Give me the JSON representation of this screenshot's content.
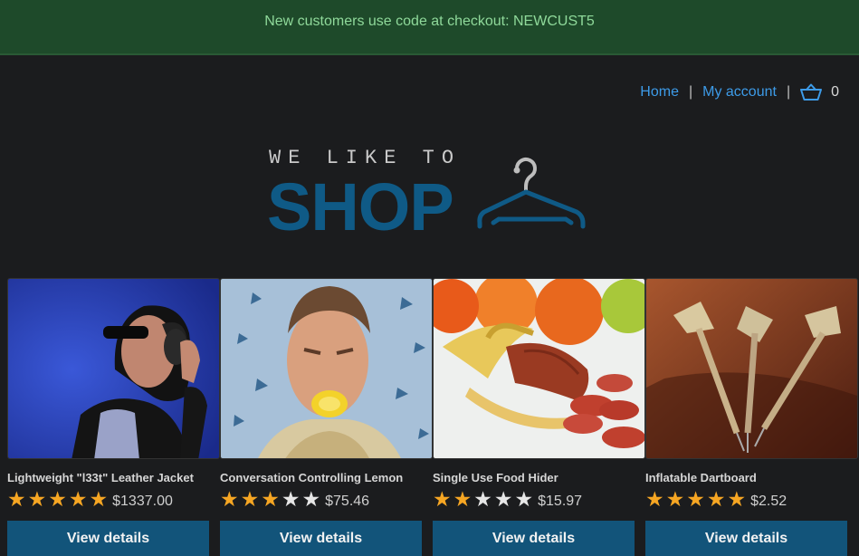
{
  "banner": {
    "text": "New customers use code at checkout: NEWCUST5"
  },
  "nav": {
    "home": "Home",
    "separator": "|",
    "account": "My account",
    "cart_count": "0"
  },
  "logo": {
    "tagline": "WE LIKE TO",
    "wordmark": "SHOP"
  },
  "products": [
    {
      "name": "Lightweight \"l33t\" Leather Jacket",
      "rating": 5,
      "price": "$1337.00",
      "button": "View details",
      "image": "person-headphones-image"
    },
    {
      "name": "Conversation Controlling Lemon",
      "rating": 3,
      "price": "$75.46",
      "button": "View details",
      "image": "man-lemon-mouth-image"
    },
    {
      "name": "Single Use Food Hider",
      "rating": 2,
      "price": "$15.97",
      "button": "View details",
      "image": "banana-sausage-image"
    },
    {
      "name": "Inflatable Dartboard",
      "rating": 5,
      "price": "$2.52",
      "button": "View details",
      "image": "darts-image"
    }
  ],
  "colors": {
    "accent": "#12547a",
    "link": "#3d9be8",
    "star": "#f6a623",
    "banner_bg": "#1e4a2a"
  }
}
